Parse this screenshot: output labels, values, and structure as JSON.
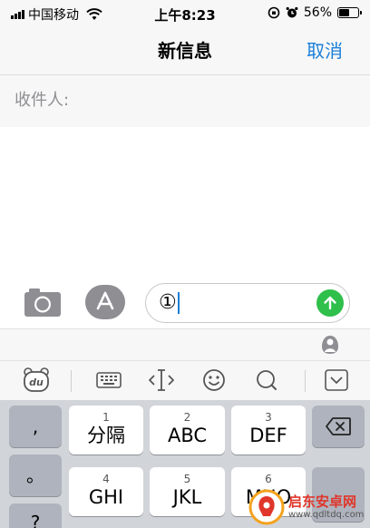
{
  "status_bar": {
    "carrier": "中国移动",
    "time": "上午8:23",
    "battery_percent": "56%",
    "battery_level": 0.56
  },
  "nav": {
    "title": "新信息",
    "cancel_label": "取消",
    "accent_color": "#1a7fd9"
  },
  "recipient": {
    "label": "收件人:"
  },
  "compose": {
    "message_text": "①",
    "camera_icon": "camera-icon",
    "appstore_icon": "app-store-icon",
    "send_icon": "arrow-up-icon",
    "send_color": "#2fbf4b"
  },
  "keyboard_toolbar": {
    "items": [
      "baidu-logo-icon",
      "keyboard-icon",
      "cursor-move-icon",
      "emoji-icon",
      "search-icon",
      "collapse-keyboard-icon"
    ]
  },
  "keyboard": {
    "punct": [
      ",",
      "。",
      "?"
    ],
    "keys": [
      {
        "num": "1",
        "label": "分隔"
      },
      {
        "num": "2",
        "label": "ABC"
      },
      {
        "num": "3",
        "label": "DEF"
      },
      {
        "num": "4",
        "label": "GHI"
      },
      {
        "num": "5",
        "label": "JKL"
      },
      {
        "num": "6",
        "label": "MNO"
      }
    ],
    "delete_icon": "backspace-icon"
  },
  "watermark": {
    "name": "启东安卓网",
    "url": "www.qdltdq.com"
  }
}
